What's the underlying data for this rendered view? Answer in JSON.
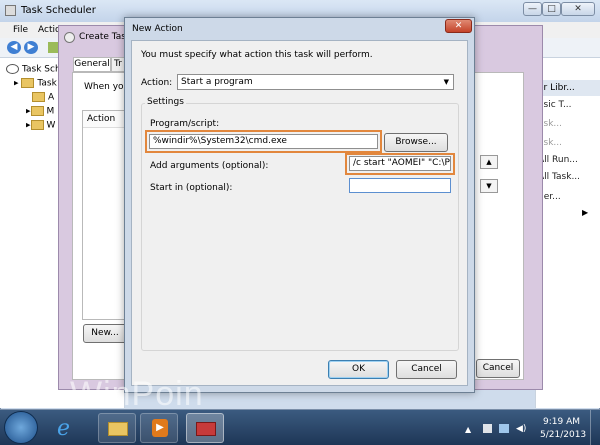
{
  "task_scheduler": {
    "title": "Task Scheduler",
    "menu": [
      "File",
      "Actio"
    ],
    "tree": {
      "root": "Task Schedul",
      "child": "Task",
      "sub_letters": [
        "A",
        "M",
        "W"
      ]
    },
    "actions_pane": {
      "header": "er Libr...",
      "items": [
        "asic T...",
        "ask...",
        "ask...",
        "All Run...",
        "All Task...",
        "der...",
        "",
        ""
      ]
    },
    "window_buttons": {
      "minimize": "—",
      "maximize": "□",
      "close": "✕"
    }
  },
  "create_task": {
    "title": "Create Task",
    "tabs": [
      "General",
      "Tr"
    ],
    "when_text": "When you",
    "table_header": "Action",
    "new_button": "New...",
    "cancel_button": "Cancel"
  },
  "new_action": {
    "title": "New Action",
    "instruction": "You must specify what action this task will perform.",
    "action_label": "Action:",
    "action_value": "Start a program",
    "settings_label": "Settings",
    "program_label": "Program/script:",
    "program_value": "%windir%\\System32\\cmd.exe",
    "browse_button": "Browse...",
    "args_label": "Add arguments (optional):",
    "args_value": "/c start \"AOMEI\" \"C:\\Pro",
    "startin_label": "Start in (optional):",
    "startin_value": "",
    "ok_button": "OK",
    "cancel_button": "Cancel"
  },
  "taskbar": {
    "time": "9:19 AM",
    "date": "5/21/2013"
  },
  "watermark": "WinPoin",
  "colors": {
    "highlight": "#e2873d",
    "taskbar": "#1e3656"
  }
}
